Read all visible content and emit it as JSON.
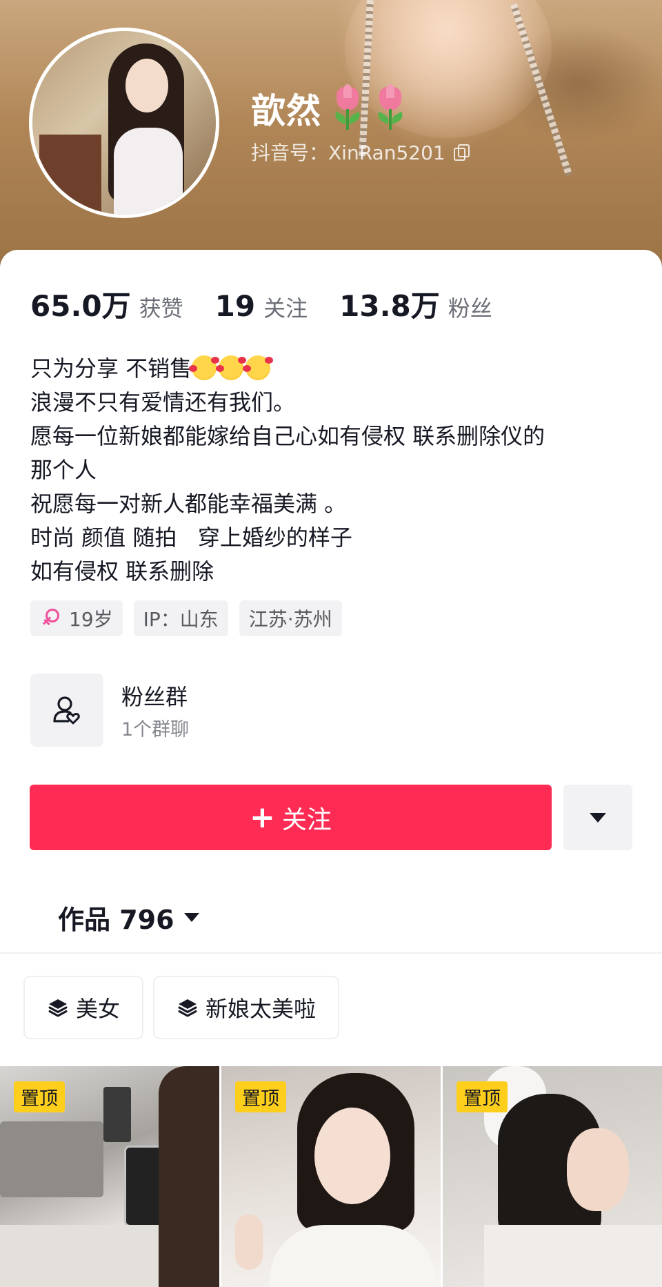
{
  "profile": {
    "nickname": "歆然",
    "nickname_emoji": "tulip",
    "douyin_id": "抖音号：XinRan5201"
  },
  "stats": [
    {
      "value": "65.0万",
      "label": "获赞"
    },
    {
      "value": "19",
      "label": "关注"
    },
    {
      "value": "13.8万",
      "label": "粉丝"
    }
  ],
  "bio": {
    "line1": "只为分享 不销售",
    "line2": "浪漫不只有爱情还有我们。",
    "line3": "愿每一位新娘都能嫁给自己心如有侵权 联系删除仪的",
    "line4": "那个人",
    "line5": "祝愿每一对新人都能幸福美满 。",
    "line6": "时尚 颜值 随拍   穿上婚纱的样子",
    "line7": "如有侵权 联系删除"
  },
  "tags": {
    "age": "19岁",
    "ip": "IP：山东",
    "location": "江苏·苏州"
  },
  "fan_group": {
    "title": "粉丝群",
    "subtitle": "1个群聊"
  },
  "actions": {
    "follow_label": "关注"
  },
  "works_tab": {
    "label": "作品 796"
  },
  "collections": [
    {
      "label": "美女"
    },
    {
      "label": "新娘太美啦"
    }
  ],
  "videos": [
    {
      "badge": "置顶"
    },
    {
      "badge": "置顶"
    },
    {
      "badge": "置顶"
    }
  ],
  "colors": {
    "accent": "#fe2c55",
    "pin_badge": "#fdcf1c",
    "female": "#f0509a"
  }
}
